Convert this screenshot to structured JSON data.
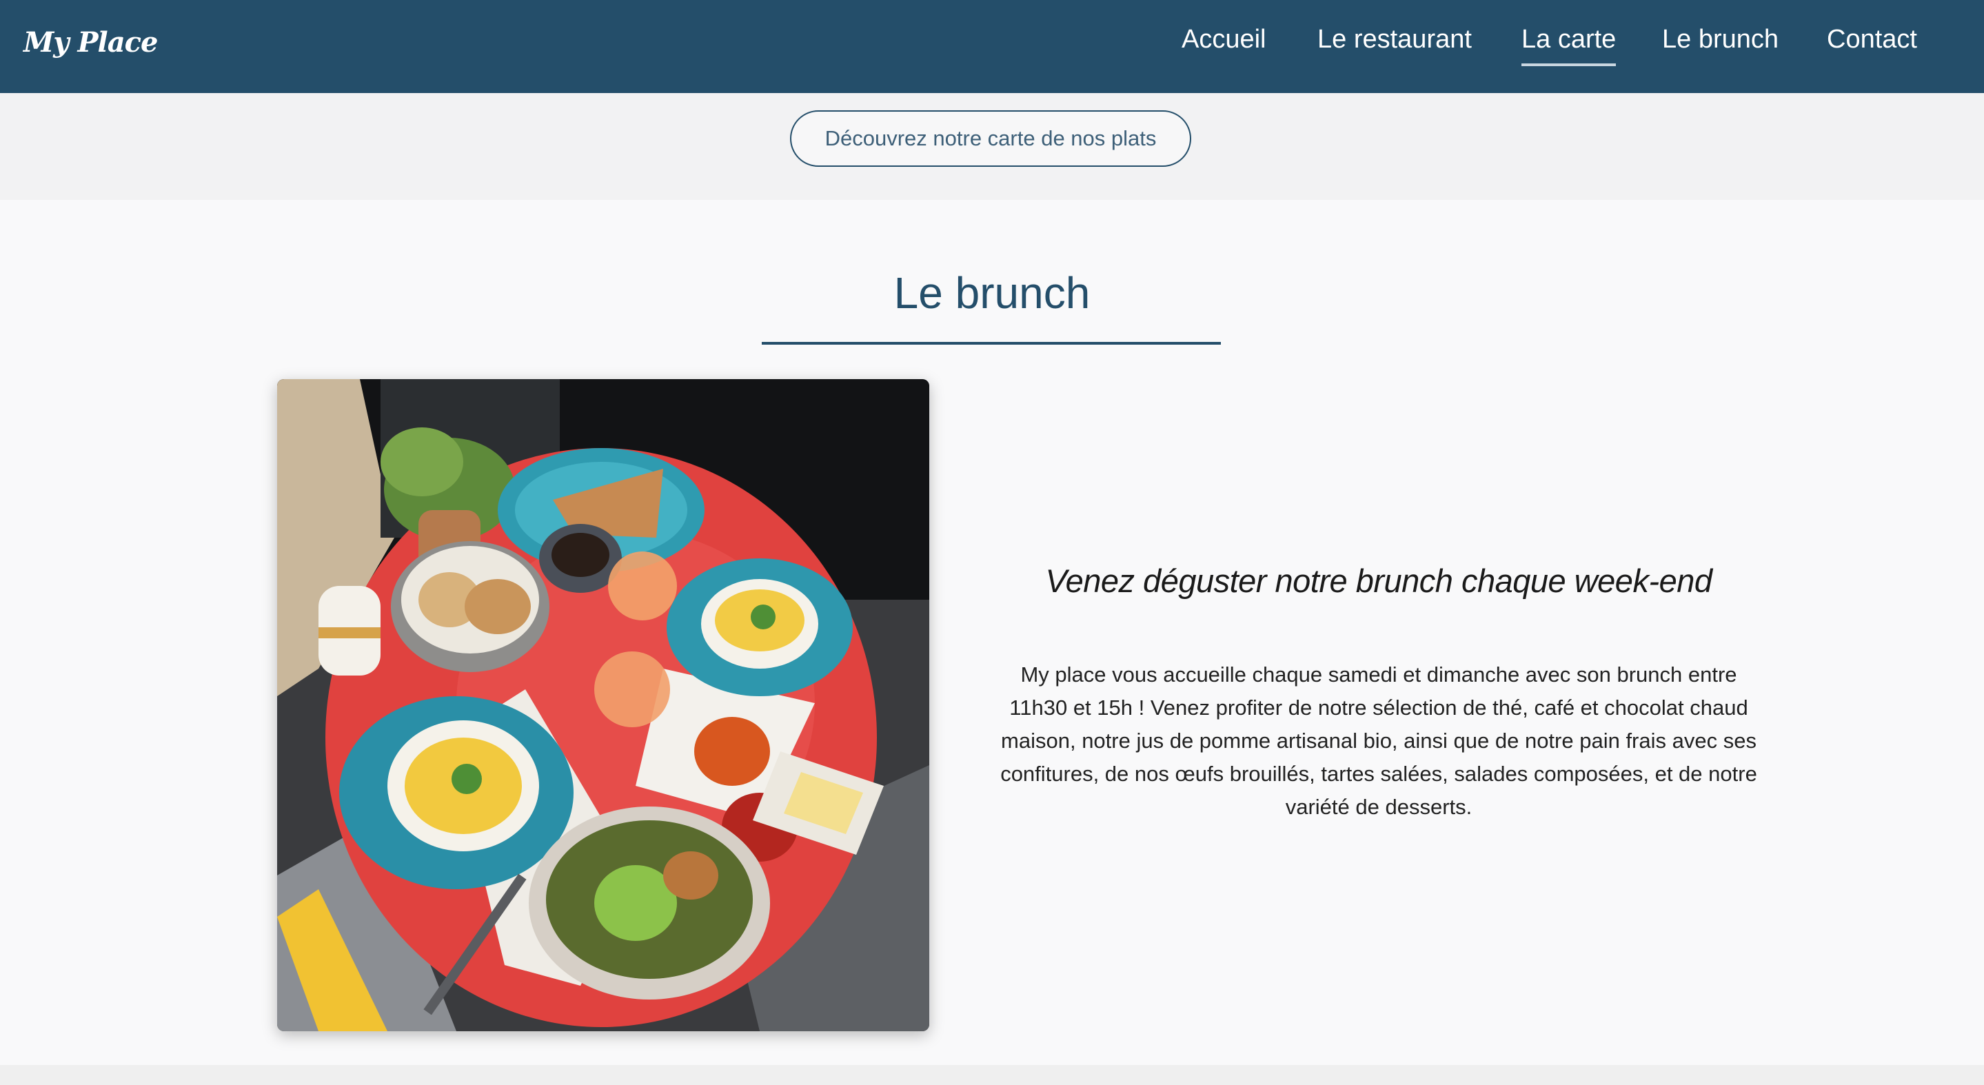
{
  "brand": {
    "logo": "My Place"
  },
  "nav": {
    "items": [
      {
        "label": "Accueil",
        "active": false
      },
      {
        "label": "Le restaurant",
        "active": false
      },
      {
        "label": "La carte",
        "active": true
      },
      {
        "label": "Le brunch",
        "active": false
      },
      {
        "label": "Contact",
        "active": false
      }
    ]
  },
  "menu_cta": {
    "label": "Découvrez notre carte de nos plats"
  },
  "brunch": {
    "title": "Le brunch",
    "tagline": "Venez déguster notre brunch chaque week-end",
    "description": "My place vous accueille chaque samedi et dimanche avec son brunch entre 11h30 et 15h ! Venez profiter de notre sélection de thé, café et chocolat chaud maison, notre jus de pomme artisanal bio, ainsi que de notre pain frais avec ses confitures, de nos œufs brouillés, tartes salées, salades composées, et de notre variété de desserts."
  },
  "colors": {
    "navbar": "#244e6a",
    "accent": "#244e6a",
    "background": "#f9f9fa"
  }
}
